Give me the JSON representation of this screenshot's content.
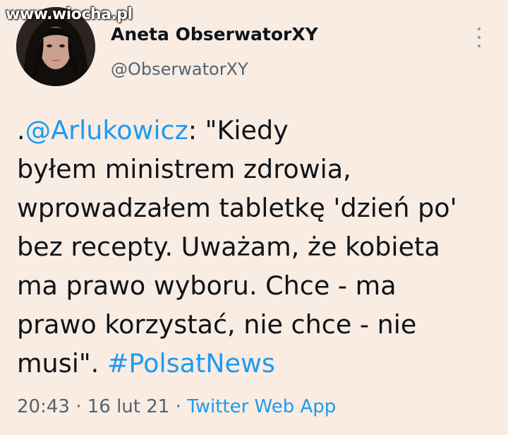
{
  "watermark": "www.wiocha.pl",
  "author": {
    "display_name": "Aneta ObserwatorXY",
    "handle": "@ObserwatorXY"
  },
  "tweet": {
    "lines": [
      {
        "prefix": ".",
        "mention": "@Arlukowicz",
        "rest": ": \"Kiedy"
      },
      {
        "text": "byłem ministrem zdrowia,"
      },
      {
        "text": "wprowadzałem tabletkę 'dzień po'"
      },
      {
        "text": "bez recepty. Uważam, że kobieta"
      },
      {
        "text": "ma prawo wyboru. Chce - ma"
      },
      {
        "text": "prawo korzystać, nie chce - nie"
      },
      {
        "text": "musi\". ",
        "hashtag": "#PolsatNews"
      }
    ]
  },
  "meta": {
    "time": "20:43",
    "separator1": " · ",
    "date": "16 lut 21",
    "separator2": " · ",
    "source": "Twitter Web App"
  },
  "icons": {
    "more": "more-vertical-icon"
  },
  "colors": {
    "background": "#f9ece3",
    "link": "#1d9bf0",
    "secondary_text": "#536471"
  }
}
